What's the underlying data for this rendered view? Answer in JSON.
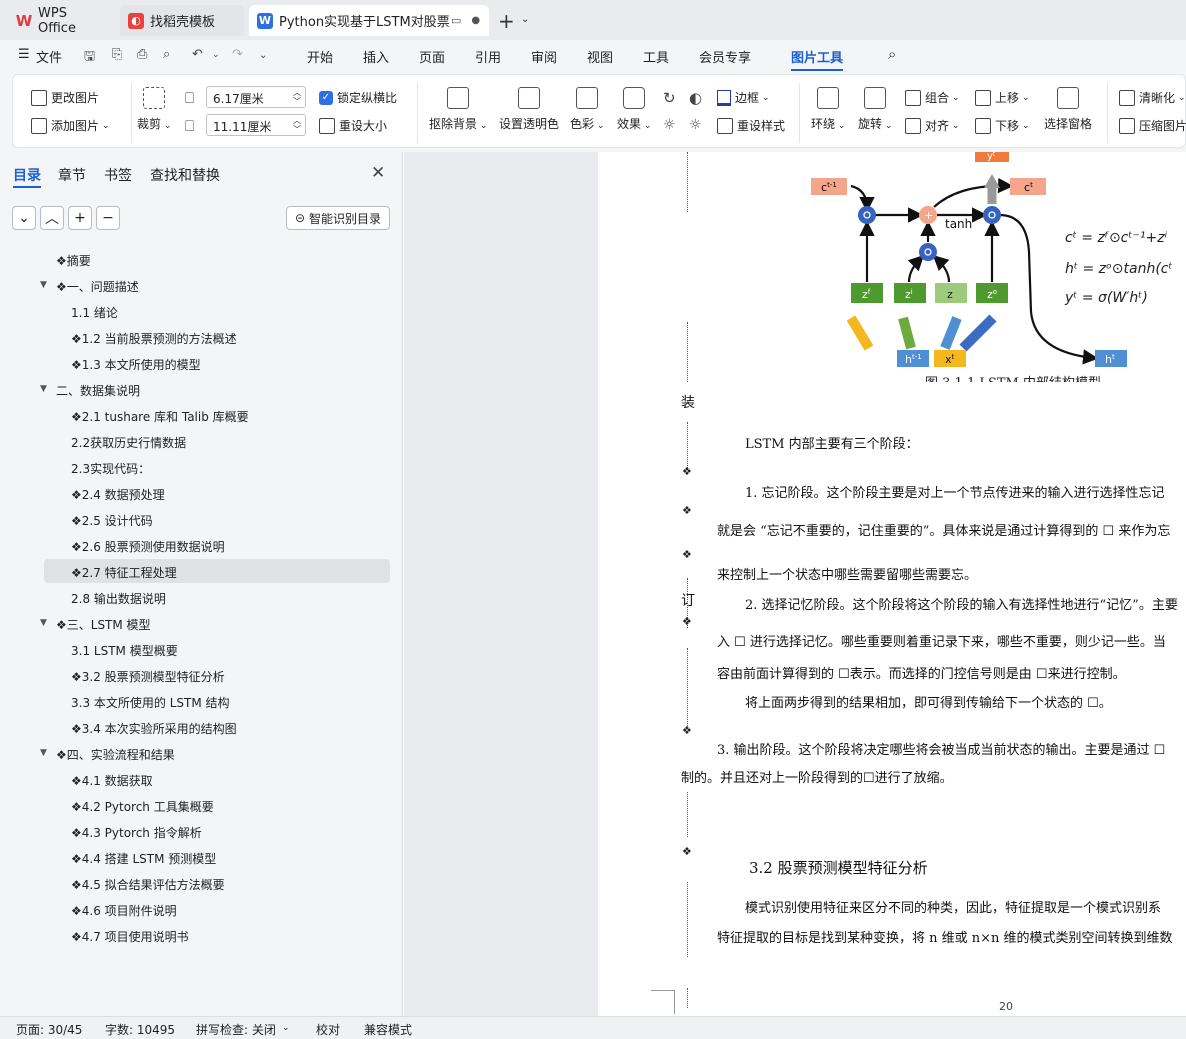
{
  "tabs": [
    {
      "label": "WPS Office",
      "icon": "wps-logo-icon",
      "color": "#e23b3b"
    },
    {
      "label": "找稻壳模板",
      "icon": "docer-icon",
      "color": "#e8423c"
    },
    {
      "label": "Python实现基于LSTM对股票走",
      "icon": "writer-icon",
      "color": "#2f6fe4"
    }
  ],
  "menu": {
    "file": "文件",
    "items": [
      "开始",
      "插入",
      "页面",
      "引用",
      "审阅",
      "视图",
      "工具",
      "会员专享",
      "图片工具"
    ],
    "active": "图片工具"
  },
  "ribbon": {
    "change_image": "更改图片",
    "add_image": "添加图片",
    "crop": "裁剪",
    "width": "6.17厘米",
    "height": "11.11厘米",
    "lock_ratio": "锁定纵横比",
    "reset_size": "重设大小",
    "remove_bg": "抠除背景",
    "set_transparent": "设置透明色",
    "color": "色彩",
    "effects": "效果",
    "border": "边框",
    "reset_style": "重设样式",
    "wrap": "环绕",
    "rotate": "旋转",
    "group": "组合",
    "align": "对齐",
    "bring_up": "上移",
    "send_down": "下移",
    "select_pane": "选择窗格",
    "sharpen": "清晰化",
    "compress": "压缩图片"
  },
  "sidebar": {
    "tabs": [
      "目录",
      "章节",
      "书签",
      "查找和替换"
    ],
    "ai_toc": "智能识别目录",
    "toc": [
      "❖摘要",
      "❖一、问题描述",
      "1.1 绪论",
      "❖1.2 当前股票预测的方法概述",
      "❖1.3 本文所使用的模型",
      "二、数据集说明",
      "❖2.1 tushare 库和 Talib 库概要",
      "2.2获取历史行情数据",
      "2.3实现代码：",
      "❖2.4 数据预处理",
      "❖2.5 设计代码",
      "❖2.6 股票预测使用数据说明",
      "❖2.7 特征工程处理",
      "2.8 输出数据说明",
      "❖三、LSTM 模型",
      "3.1 LSTM 模型概要",
      "❖3.2 股票预测模型特征分析",
      "3.3 本文所使用的 LSTM 结构",
      "❖3.4 本次实验所采用的结构图",
      "❖四、实验流程和结果",
      "❖4.1 数据获取",
      "❖4.2 Pytorch 工具集概要",
      "❖4.3 Pytorch 指令解析",
      "❖4.4 搭建 LSTM 预测模型",
      "❖4.5 拟合结果评估方法概要",
      "❖4.6 项目附件说明",
      "❖4.7 项目使用说明书"
    ]
  },
  "figure": {
    "ct1": "c",
    "ct1_sup": "t-1",
    "ct": "c",
    "ct_sup": "t",
    "yt": "y",
    "yt_sup": "t",
    "ht1": "h",
    "ht1_sup": "t-1",
    "xt": "x",
    "xt_sup": "t",
    "ht": "h",
    "ht_sup": "t",
    "tanh": "tanh",
    "zf": "z",
    "zf_sup": "f",
    "zi": "z",
    "zi_sup": "i",
    "z": "z",
    "zo": "z",
    "zo_sup": "o",
    "eq1": "cᵗ = zᶠ⊙cᵗ⁻¹+zⁱ",
    "eq2": "hᵗ = zᵒ⊙tanh(cᵗ",
    "eq3": "yᵗ = σ(W′hᵗ)",
    "caption": "图 3.1.1 LSTM 内部结构模型"
  },
  "doc": {
    "margin_zhuang": "装",
    "margin_ding": "订",
    "p0": "LSTM 内部主要有三个阶段：",
    "p1a": "1. 忘记阶段。这个阶段主要是对上一个节点传进来的输入进行选择性忘记",
    "p1b": "就是会 “忘记不重要的，记住重要的”。具体来说是通过计算得到的 ☐ 来作为忘",
    "p1c": "来控制上一个状态中哪些需要留哪些需要忘。",
    "p2a": "2. 选择记忆阶段。这个阶段将这个阶段的输入有选择性地进行“记忆”。主要",
    "p2b": "入 ☐ 进行选择记忆。哪些重要则着重记录下来，哪些不重要，则少记一些。当",
    "p2c": "容由前面计算得到的 ☐表示。而选择的门控信号则是由 ☐来进行控制。",
    "p2d": "将上面两步得到的结果相加，即可得到传输给下一个状态的 ☐。",
    "p3a": "3. 输出阶段。这个阶段将决定哪些将会被当成当前状态的输出。主要是通过 ☐",
    "p3b": "制的。并且还对上一阶段得到的☐进行了放缩。",
    "h32": "3.2  股票预测模型特征分析",
    "p4a": "模式识别使用特征来区分不同的种类，因此，特征提取是一个模式识别系",
    "p4b": "特征提取的目标是找到某种变换，将 n 维或 n×n 维的模式类别空间转换到维数",
    "page_no": "20"
  },
  "status": {
    "page": "页面: 30/45",
    "words": "字数: 10495",
    "spell": "拼写检查: 关闭",
    "proof": "校对",
    "compat": "兼容模式"
  }
}
